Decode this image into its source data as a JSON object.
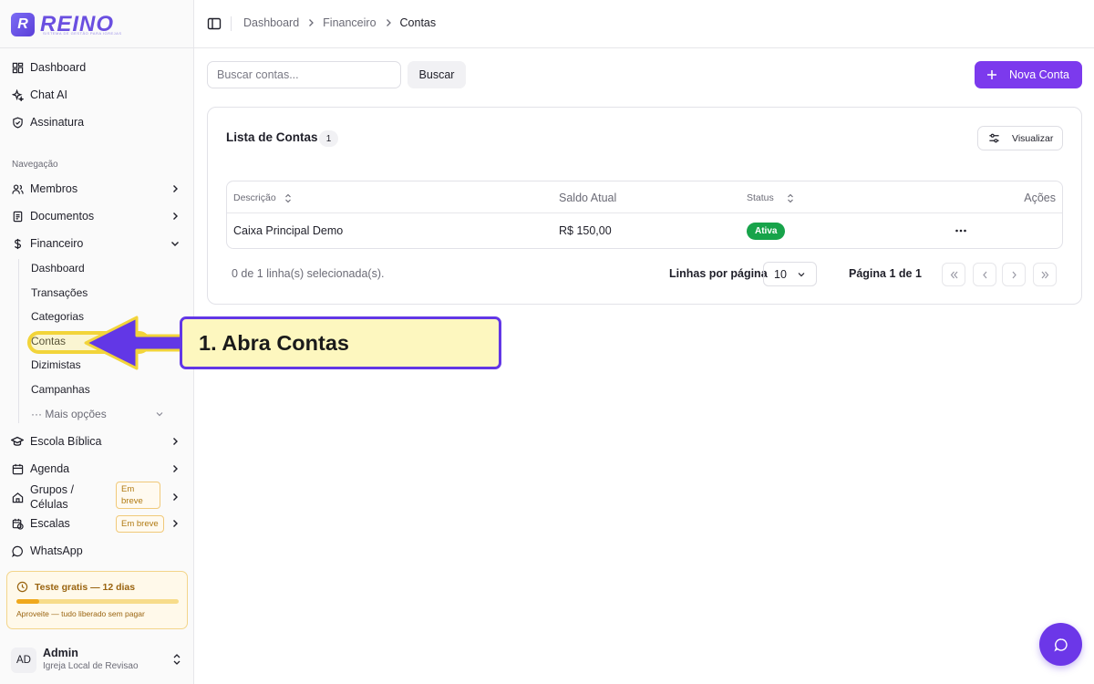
{
  "brand": {
    "name": "REINO",
    "mark": "R",
    "tagline": "SISTEMA DE GESTÃO PARA IGREJAS"
  },
  "sidebar": {
    "top_items": [
      {
        "label": "Dashboard",
        "icon": "grid-icon"
      },
      {
        "label": "Chat AI",
        "icon": "sparkles-icon"
      },
      {
        "label": "Assinatura",
        "icon": "shield-icon"
      }
    ],
    "section_label": "Navegação",
    "nav_items": [
      {
        "label": "Membros",
        "icon": "users-icon"
      },
      {
        "label": "Documentos",
        "icon": "document-icon"
      },
      {
        "label": "Financeiro",
        "icon": "dollar-icon",
        "expanded": true
      }
    ],
    "finance_sub": [
      "Dashboard",
      "Transações",
      "Categorias",
      "Contas",
      "Dizimistas",
      "Campanhas"
    ],
    "more_options": "··· Mais opções",
    "bottom_items": [
      {
        "label": "Escola Bíblica",
        "icon": "graduation-cap-icon"
      },
      {
        "label": "Agenda",
        "icon": "calendar-icon"
      },
      {
        "label": "Grupos /",
        "label2": "Células",
        "icon": "home-icon",
        "badge": "Em breve"
      },
      {
        "label": "Escalas",
        "icon": "calendar-clock-icon",
        "badge": "Em breve"
      },
      {
        "label": "WhatsApp",
        "icon": "chat-bubble-icon"
      }
    ],
    "trial": {
      "title": "Teste gratis — 12 dias",
      "note": "Aproveite — tudo liberado sem pagar",
      "progress": 0.14
    },
    "user": {
      "initials": "AD",
      "name": "Admin",
      "org": "Igreja Local de Revisao"
    }
  },
  "header": {
    "breadcrumbs": [
      "Dashboard",
      "Financeiro",
      "Contas"
    ]
  },
  "toolbar": {
    "search_placeholder": "Buscar contas...",
    "search_button": "Buscar",
    "new_button": "Nova Conta"
  },
  "card": {
    "title": "Lista de Contas",
    "count": "1",
    "view_button": "Visualizar",
    "columns": {
      "description": "Descrição",
      "balance": "Saldo Atual",
      "status": "Status",
      "actions": "Ações"
    },
    "rows": [
      {
        "description": "Caixa Principal Demo",
        "balance": "R$ 150,00",
        "status": "Ativa"
      }
    ],
    "selection_text": "0 de 1 linha(s) selecionada(s).",
    "rows_per_page_label": "Linhas por página",
    "rows_per_page_value": "10",
    "page_label": "Página 1 de 1"
  },
  "annotation": {
    "text": "1. Abra Contas"
  },
  "colors": {
    "accent": "#7c3aed",
    "success": "#17a34a",
    "callout_border": "#6237e6",
    "callout_fill": "#fdf7bf",
    "highlight": "#f2d43a"
  }
}
